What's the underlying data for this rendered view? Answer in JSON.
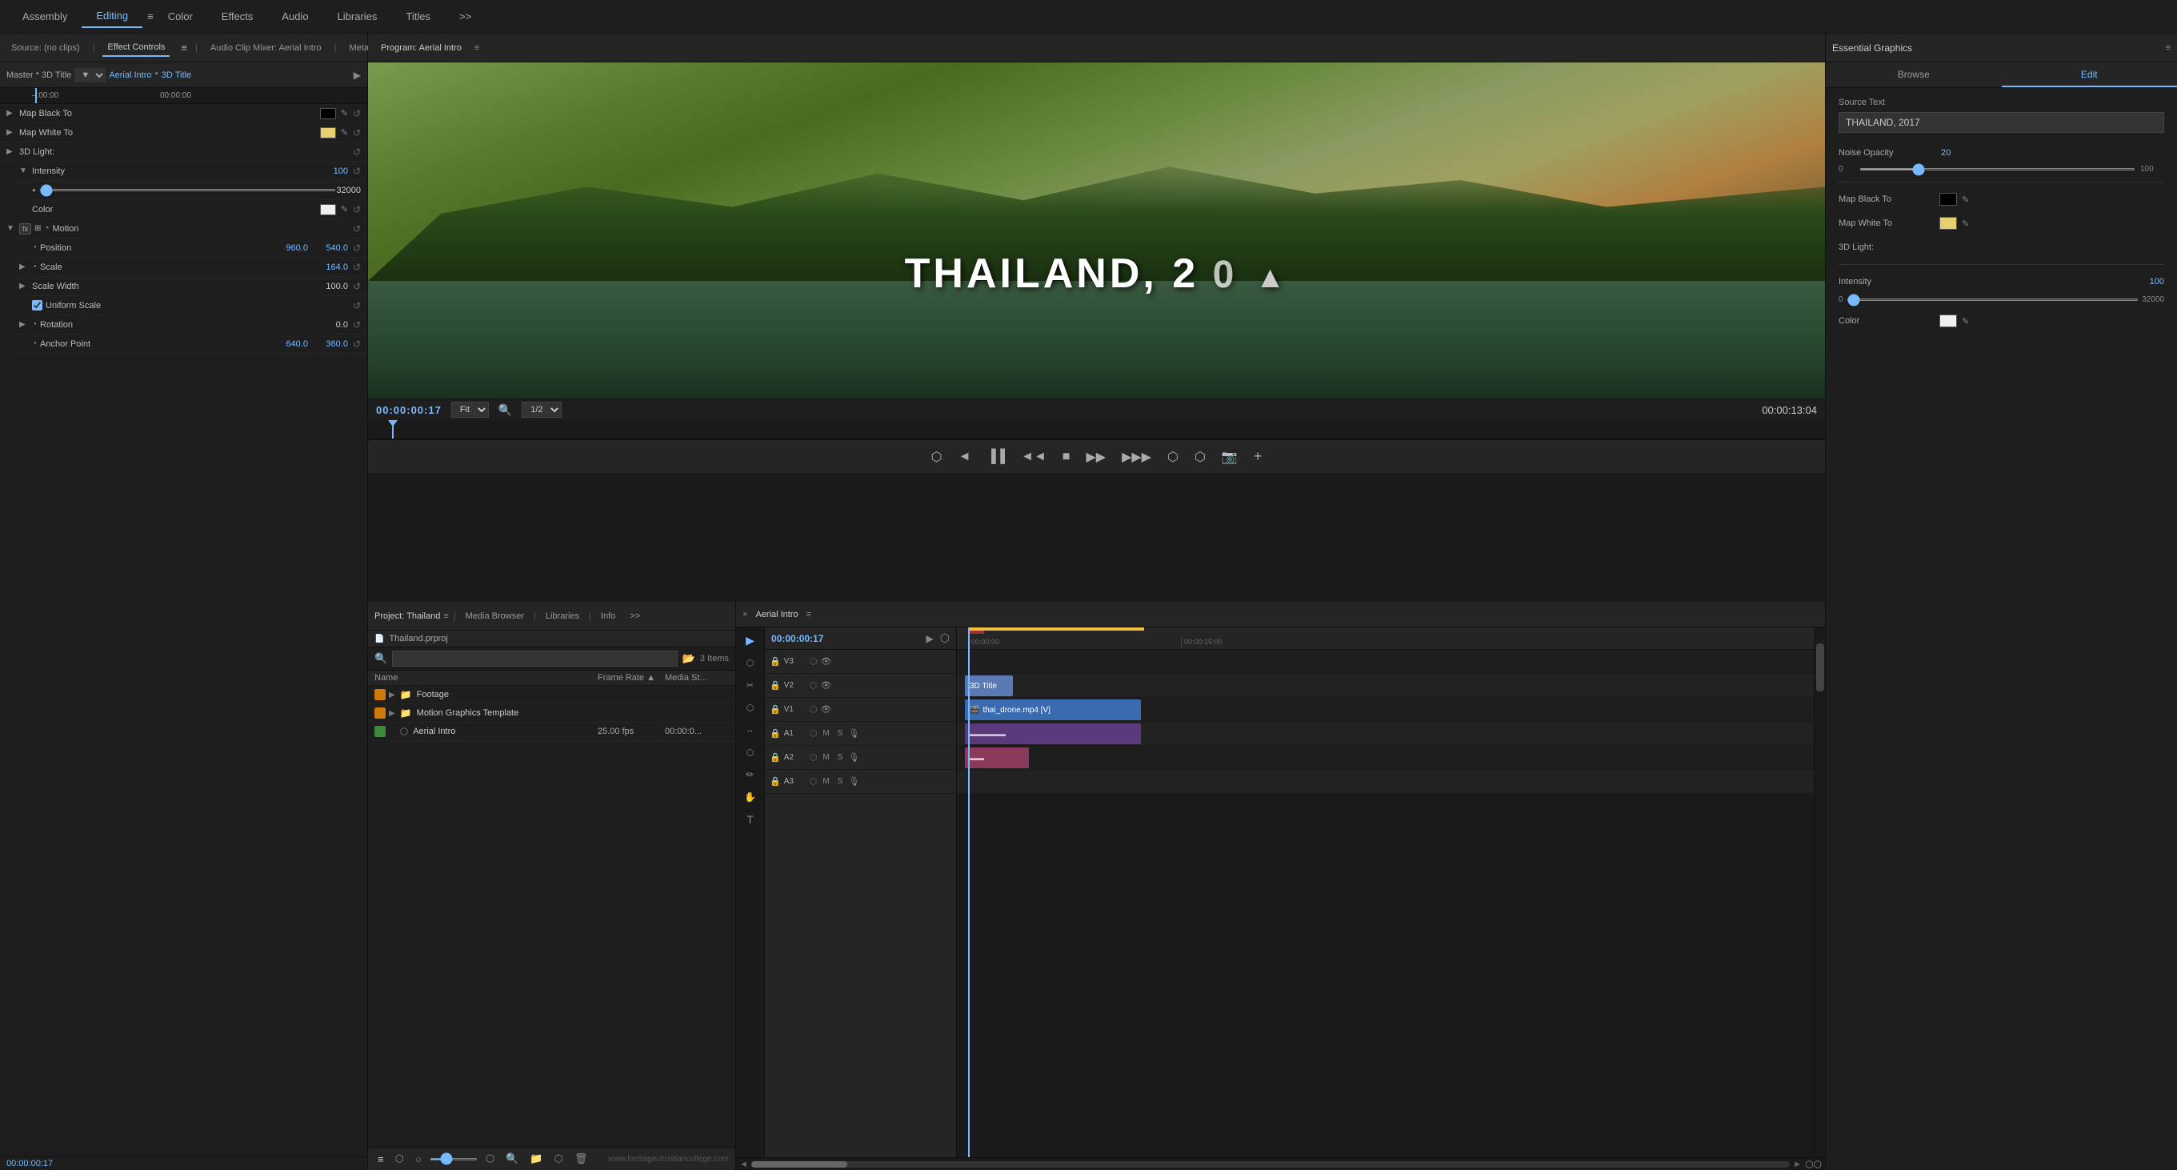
{
  "topNav": {
    "items": [
      {
        "label": "Assembly",
        "active": false
      },
      {
        "label": "Editing",
        "active": true
      },
      {
        "label": "Color",
        "active": false
      },
      {
        "label": "Effects",
        "active": false
      },
      {
        "label": "Audio",
        "active": false
      },
      {
        "label": "Libraries",
        "active": false
      },
      {
        "label": "Titles",
        "active": false
      }
    ],
    "more": ">>"
  },
  "leftPanel": {
    "tabs": [
      {
        "label": "Source: (no clips)",
        "active": false
      },
      {
        "label": "Effect Controls",
        "active": true
      },
      {
        "label": "Audio Clip Mixer: Aerial Intro",
        "active": false
      },
      {
        "label": "Meta...",
        "active": false
      }
    ],
    "header": {
      "master_label": "Master * 3D Title",
      "clip_dropdown": "▼",
      "clip_link1": "Aerial Intro",
      "star": "* ",
      "clip_link2": "3D Title"
    },
    "timecodes": [
      "–:00:00",
      "00:00:00"
    ],
    "properties": [
      {
        "indent": 0,
        "expand": "▶",
        "label": "Map Black To",
        "type": "color",
        "color": "#000000",
        "reset": true
      },
      {
        "indent": 0,
        "expand": "▶",
        "label": "Map White To",
        "type": "color",
        "color": "#f0d890",
        "reset": true
      },
      {
        "indent": 0,
        "expand": "▶",
        "label": "3D Light:",
        "type": "label",
        "reset": true
      },
      {
        "indent": 1,
        "expand": "▼",
        "label": "Intensity",
        "type": "value",
        "value": "100",
        "reset": true
      },
      {
        "indent": 2,
        "type": "range",
        "min": "",
        "max": "32000"
      },
      {
        "indent": 2,
        "label": "Color",
        "type": "color",
        "color": "#f0f0f0",
        "reset": true
      },
      {
        "indent": 0,
        "fx": true,
        "motion": true,
        "expand": "▼",
        "label": "Motion",
        "type": "group",
        "reset": true
      },
      {
        "indent": 1,
        "expand": "",
        "label": "Position",
        "type": "value2",
        "value1": "960.0",
        "value2": "540.0",
        "reset": true
      },
      {
        "indent": 1,
        "expand": "▶",
        "label": "Scale",
        "type": "value",
        "value": "164.0",
        "reset": true
      },
      {
        "indent": 1,
        "expand": "▶",
        "label": "Scale Width",
        "type": "value",
        "value": "100.0",
        "reset": true
      },
      {
        "indent": 2,
        "label": "Uniform Scale",
        "type": "checkbox",
        "checked": true,
        "reset": true
      },
      {
        "indent": 1,
        "expand": "▶",
        "label": "Rotation",
        "type": "value",
        "value": "0.0",
        "reset": true
      },
      {
        "indent": 1,
        "expand": "",
        "label": "Anchor Point",
        "type": "value2",
        "value1": "640.0",
        "value2": "360.0",
        "reset": true
      }
    ],
    "currentTime": "00:00:00:17"
  },
  "programMonitor": {
    "title": "Program: Aerial Intro",
    "menuIcon": "≡",
    "timecodeCurrent": "00:00:00:17",
    "fitLabel": "Fit",
    "quality": "1/2",
    "totalDuration": "00:00:13:04",
    "videoText": "THAILAND, 2",
    "controls": [
      "⬡",
      "◄",
      "▐▐",
      "◄◄",
      "■",
      "▶▶",
      "▶▶▶",
      "⬡",
      "⬡",
      "📷"
    ]
  },
  "timeline": {
    "title": "Aerial Intro",
    "menuIcon": "≡",
    "closeIcon": "×",
    "timecode": "00:00:00:17",
    "rulerMarks": [
      "00:00:00",
      "",
      "00:00:15:00"
    ],
    "tracks": [
      {
        "name": "V3",
        "type": "video"
      },
      {
        "name": "V2",
        "type": "video"
      },
      {
        "name": "V1",
        "type": "video"
      },
      {
        "name": "A1",
        "type": "audio"
      },
      {
        "name": "A2",
        "type": "audio"
      },
      {
        "name": "A3",
        "type": "audio"
      }
    ],
    "clips": [
      {
        "track": "V2",
        "label": "3D Title",
        "type": "title"
      },
      {
        "track": "V1",
        "label": "thai_drone.mp4 [V]",
        "type": "video"
      },
      {
        "track": "A1",
        "label": "",
        "type": "audio"
      },
      {
        "track": "A2",
        "label": "",
        "type": "audio2"
      }
    ],
    "tools": [
      "▶",
      "⬡",
      "✂",
      "⬡",
      "↔",
      "⬡",
      "✏",
      "✋",
      "T"
    ]
  },
  "projectPanel": {
    "title": "Project: Thailand",
    "menuIcon": "≡",
    "tabs": [
      "Media Browser",
      "Libraries",
      "Info",
      ">>"
    ],
    "searchPlaceholder": "",
    "itemCount": "3 Items",
    "projectFile": "Thailand.prproj",
    "columns": {
      "name": "Name",
      "fps": "Frame Rate ▲",
      "media": "Media St..."
    },
    "items": [
      {
        "name": "Footage",
        "type": "folder",
        "icon": "orange",
        "fps": "",
        "media": ""
      },
      {
        "name": "Motion Graphics Template",
        "type": "folder",
        "icon": "orange",
        "fps": "",
        "media": ""
      },
      {
        "name": "Aerial Intro",
        "type": "sequence",
        "icon": "green",
        "fps": "25.00 fps",
        "media": "00:00:0..."
      }
    ],
    "bottomTools": [
      "≡",
      "⬡",
      "○",
      "⬡",
      "⬡",
      "🔍",
      "📁",
      "⬡",
      "🗑"
    ]
  },
  "essentialGraphics": {
    "title": "Essential Graphics",
    "menuIcon": "≡",
    "tabs": [
      "Browse",
      "Edit"
    ],
    "activeTab": "Edit",
    "sourceTextLabel": "Source Text",
    "sourceTextValue": "THAILAND, 2017",
    "noiseOpacityLabel": "Noise Opacity",
    "noiseOpacityValue": "20",
    "sliderMin": "0",
    "sliderMax": "100",
    "mapBlackToLabel": "Map Black To",
    "mapBlackColor": "#000000",
    "mapWhiteToLabel": "Map White To",
    "mapWhiteColor": "#f0d890",
    "threeDLightLabel": "3D Light:",
    "intensityLabel": "Intensity",
    "intensityValue": "100",
    "intensityMin": "0",
    "intensityMax": "32000",
    "colorLabel": "Color",
    "colorValue": "#f0f0f0"
  }
}
